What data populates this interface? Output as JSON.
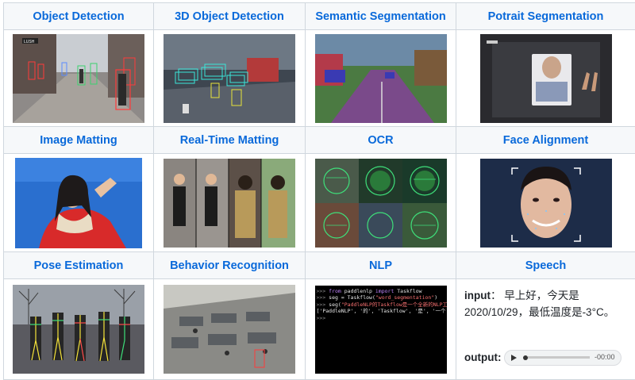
{
  "row1": {
    "headers": [
      "Object Detection",
      "3D Object Detection",
      "Semantic Segmentation",
      "Potrait Segmentation"
    ],
    "sign_text": "LUSH"
  },
  "row2": {
    "headers": [
      "Image Matting",
      "Real-Time Matting",
      "OCR",
      "Face Alignment"
    ]
  },
  "row3": {
    "headers": [
      "Pose Estimation",
      "Behavior Recognition",
      "NLP",
      "Speech"
    ]
  },
  "nlp_demo": {
    "prompt": ">>>",
    "line1": {
      "kw1": "from",
      "mod": " paddlenlp ",
      "kw2": "import",
      "rest": " Taskflow"
    },
    "line2": {
      "pre": " seg = Taskflow(",
      "str": "\"word_segmentation\"",
      "post": ")"
    },
    "line3": {
      "pre": " seg(",
      "str": "\"PaddleNLP的Taskflow是一个全新的NLP工具\"",
      "post": ")"
    },
    "line4": "['PaddleNLP', '的', 'Taskflow', '是', '一个'"
  },
  "speech": {
    "input_label": "input",
    "input_text": "： 早上好，今天是2020/10/29，最低温度是-3°C。",
    "output_label": "output:",
    "audio_time": "-00:00"
  },
  "colors": {
    "header_text": "#0969da",
    "header_bg": "#f6f8fa",
    "border": "#d0d7de"
  }
}
